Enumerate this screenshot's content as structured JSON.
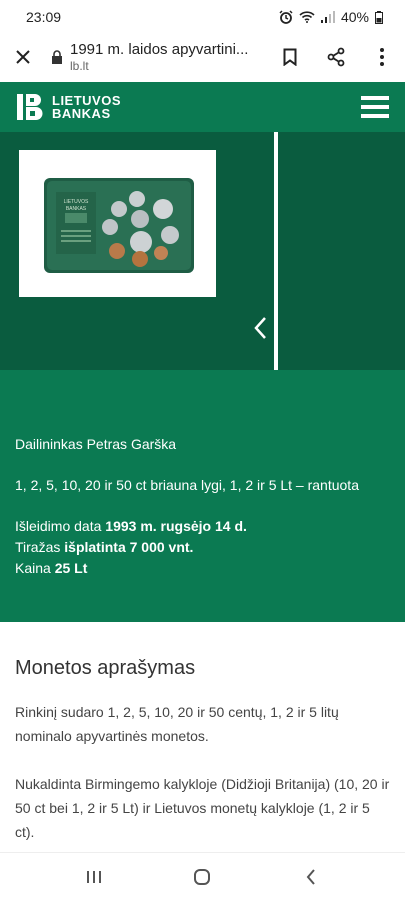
{
  "status_bar": {
    "time": "23:09",
    "battery": "40%"
  },
  "browser": {
    "page_title": "1991 m. laidos apyvartini...",
    "domain": "lb.lt",
    "icons": {
      "close": "close-icon",
      "lock": "lock-icon",
      "bookmark": "bookmark-icon",
      "share": "share-icon",
      "menu": "more-vert-icon"
    }
  },
  "site_header": {
    "logo_line1": "LIETUVOS",
    "logo_line2": "BANKAS",
    "menu_icon": "hamburger-icon"
  },
  "colors": {
    "brand_green": "#0b7a52",
    "gallery_dark_green": "#0a5c3f",
    "white": "#ffffff"
  },
  "gallery": {
    "prev_icon": "chevron-left-icon",
    "set_card_label_line1": "LIETUVOS",
    "set_card_label_line2": "BANKAS"
  },
  "info": {
    "artist": "Dailininkas Petras Garška",
    "edge": "1, 2, 5, 10, 20 ir 50 ct briauna lygi, 1, 2 ir 5 Lt – rantuota",
    "issue_label": "Išleidimo data ",
    "issue_value": "1993 m. rugsėjo 14 d.",
    "mintage_label": "Tiražas ",
    "mintage_value": "išplatinta 7 000 vnt.",
    "price_label": "Kaina ",
    "price_value": "25 Lt"
  },
  "description": {
    "title": "Monetos aprašymas",
    "p1": "Rinkinį sudaro 1, 2, 5, 10, 20 ir 50 centų, 1, 2 ir 5 litų nominalo apyvartinės monetos.",
    "p2": "Nukaldinta Birmingemo kalykloje (Didžioji Britanija) (10, 20 ir 50 ct bei 1, 2 ir 5 Lt) ir Lietuvos monetų kalykloje (1, 2 ir 5 ct)."
  },
  "nav_bar": {
    "recents": "recents-icon",
    "home": "home-icon",
    "back": "back-icon"
  }
}
